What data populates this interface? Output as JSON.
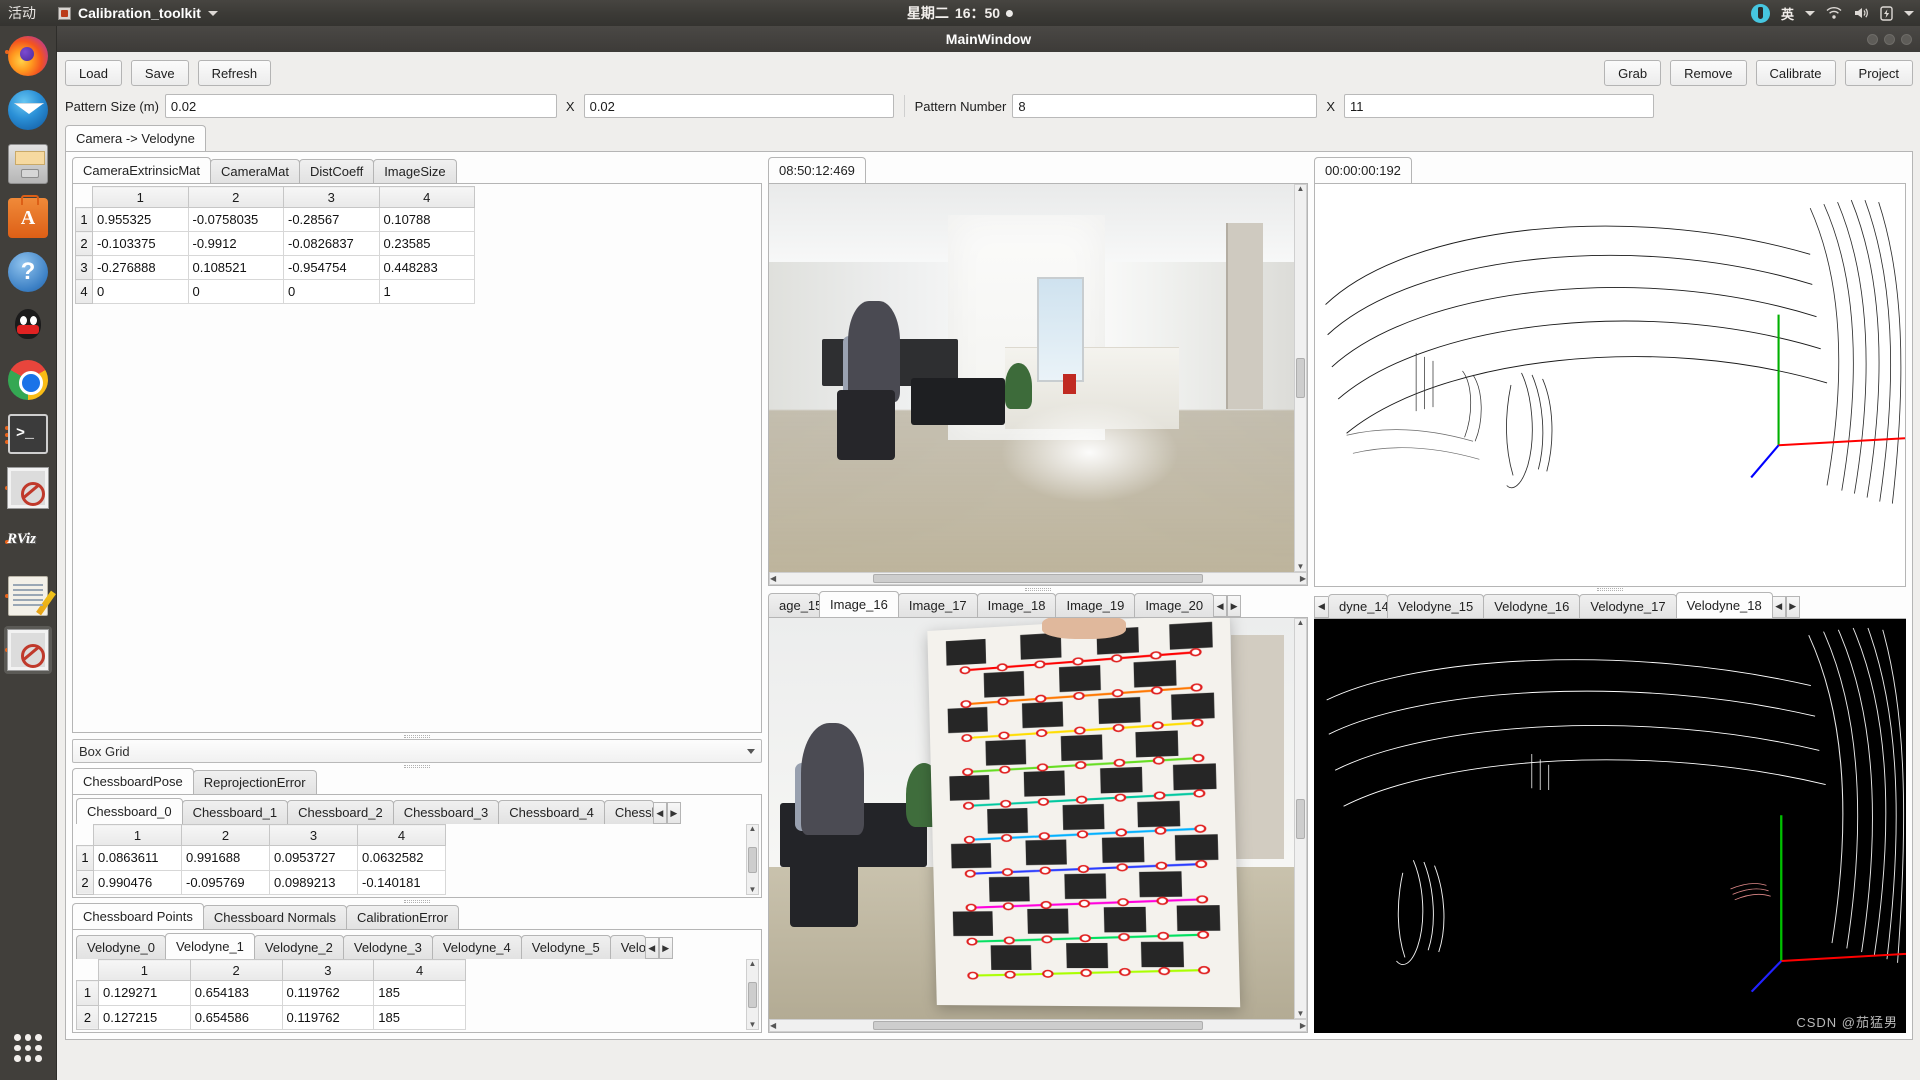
{
  "desktop": {
    "activities": "活动",
    "app_menu": "Calibration_toolkit",
    "clock_day": "星期二",
    "clock_time": "16：50",
    "lang_indicator": "英",
    "tray_icons": [
      "dropbox-icon",
      "language-icon",
      "wifi-icon",
      "volume-icon",
      "battery-icon",
      "system-menu-icon"
    ],
    "dock_items": [
      {
        "name": "firefox-icon",
        "label": "Firefox"
      },
      {
        "name": "thunderbird-icon",
        "label": "Thunderbird Mail"
      },
      {
        "name": "files-icon",
        "label": "Files"
      },
      {
        "name": "software-icon",
        "label": "Ubuntu Software"
      },
      {
        "name": "help-icon",
        "label": "Help"
      },
      {
        "name": "qq-icon",
        "label": "QQ"
      },
      {
        "name": "chrome-icon",
        "label": "Google Chrome"
      },
      {
        "name": "terminal-icon",
        "label": "Terminal"
      },
      {
        "name": "deny-app-icon",
        "label": "Application"
      },
      {
        "name": "rviz-icon",
        "label": "RViz"
      },
      {
        "name": "notes-icon",
        "label": "Text Editor"
      },
      {
        "name": "calibration-toolkit-icon",
        "label": "Calibration_toolkit"
      },
      {
        "name": "show-applications-icon",
        "label": "Show Applications"
      }
    ]
  },
  "window": {
    "title": "MainWindow"
  },
  "toolbar": {
    "load_label": "Load",
    "save_label": "Save",
    "refresh_label": "Refresh",
    "grab_label": "Grab",
    "remove_label": "Remove",
    "calibrate_label": "Calibrate",
    "project_label": "Project"
  },
  "params": {
    "pattern_size_label": "Pattern Size (m)",
    "pattern_size_x": "0.02",
    "pattern_size_sep": "X",
    "pattern_size_y": "0.02",
    "pattern_number_label": "Pattern Number",
    "pattern_number_x": "8",
    "pattern_number_sep": "X",
    "pattern_number_y": "11"
  },
  "main_tab": {
    "label": "Camera -> Velodyne"
  },
  "calib_tabs": {
    "items": [
      "CameraExtrinsicMat",
      "CameraMat",
      "DistCoeff",
      "ImageSize"
    ],
    "selected": "CameraExtrinsicMat"
  },
  "extrinsic_table": {
    "columns": [
      "1",
      "2",
      "3",
      "4"
    ],
    "rows": [
      {
        "index": "1",
        "cells": [
          "0.955325",
          "-0.0758035",
          "-0.28567",
          "0.10788"
        ]
      },
      {
        "index": "2",
        "cells": [
          "-0.103375",
          "-0.9912",
          "-0.0826837",
          "0.23585"
        ]
      },
      {
        "index": "3",
        "cells": [
          "-0.276888",
          "0.108521",
          "-0.954754",
          "0.448283"
        ]
      },
      {
        "index": "4",
        "cells": [
          "0",
          "0",
          "0",
          "1"
        ]
      }
    ]
  },
  "box_grid_combo": {
    "value": "Box Grid"
  },
  "pose_tabs": {
    "items": [
      "ChessboardPose",
      "ReprojectionError"
    ],
    "selected": "ChessboardPose"
  },
  "chessboard_tabs": {
    "items": [
      "Chessboard_0",
      "Chessboard_1",
      "Chessboard_2",
      "Chessboard_3",
      "Chessboard_4",
      "Chessb"
    ],
    "selected": "Chessboard_0"
  },
  "chessboard_table": {
    "columns": [
      "1",
      "2",
      "3",
      "4"
    ],
    "rows": [
      {
        "index": "1",
        "cells": [
          "0.0863611",
          "0.991688",
          "0.0953727",
          "0.0632582"
        ]
      },
      {
        "index": "2",
        "cells": [
          "0.990476",
          "-0.095769",
          "0.0989213",
          "-0.140181"
        ]
      }
    ]
  },
  "points_tabs": {
    "items": [
      "Chessboard Points",
      "Chessboard Normals",
      "CalibrationError"
    ],
    "selected": "Chessboard Points"
  },
  "velodyne_point_tabs": {
    "items": [
      "Velodyne_0",
      "Velodyne_1",
      "Velodyne_2",
      "Velodyne_3",
      "Velodyne_4",
      "Velodyne_5",
      "Velo"
    ],
    "selected": "Velodyne_1"
  },
  "points_table": {
    "columns": [
      "1",
      "2",
      "3",
      "4"
    ],
    "rows": [
      {
        "index": "1",
        "cells": [
          "0.129271",
          "0.654183",
          "0.119762",
          "185"
        ]
      },
      {
        "index": "2",
        "cells": [
          "0.127215",
          "0.654586",
          "0.119762",
          "185"
        ]
      }
    ]
  },
  "camera_top": {
    "timestamp_tab": "08:50:12:469"
  },
  "image_tabs": {
    "items": [
      "age_15",
      "Image_16",
      "Image_17",
      "Image_18",
      "Image_19",
      "Image_20"
    ],
    "selected": "Image_16"
  },
  "velodyne_top": {
    "timestamp_tab": "00:00:00:192"
  },
  "velodyne_tabs": {
    "items": [
      "dyne_14",
      "Velodyne_15",
      "Velodyne_16",
      "Velodyne_17",
      "Velodyne_18"
    ],
    "selected": "Velodyne_18"
  },
  "watermark": "CSDN @茄猛男",
  "colors": {
    "accent_orange": "#e8641c",
    "panel_bg": "#efeeec",
    "titlebar": "#3d3b38",
    "axis_x": "#ff0000",
    "axis_y": "#00b000",
    "axis_z": "#0000ff"
  }
}
